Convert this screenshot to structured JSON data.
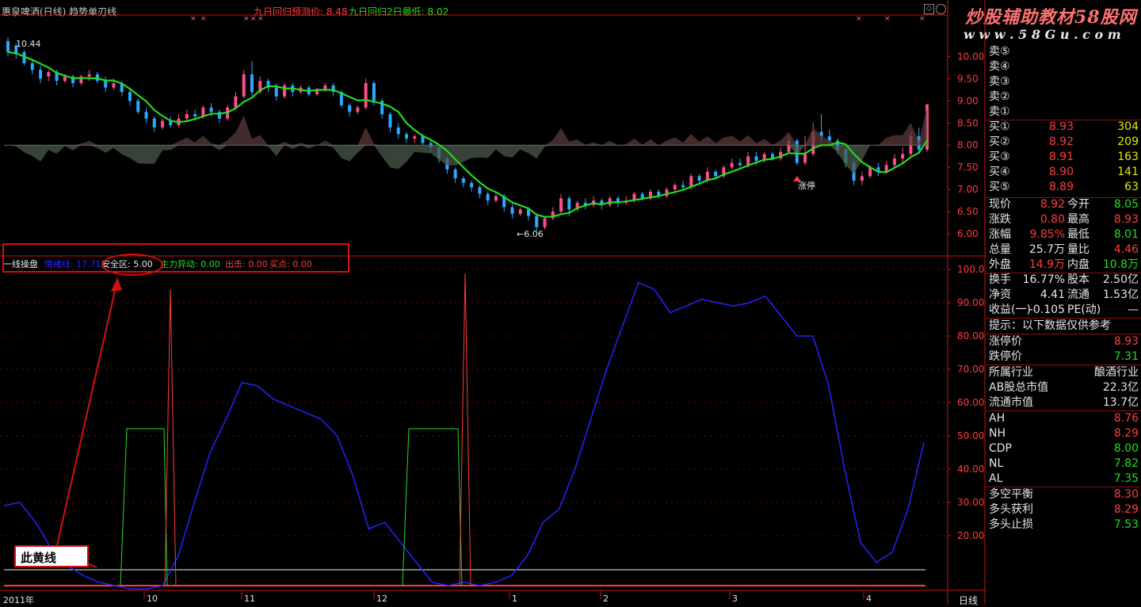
{
  "header": {
    "stock_title": "惠泉啤酒(日线) 趋势单刃线",
    "indicator_1": "九日回归预测价: 8.48",
    "indicator_2": "九日回归2日最低: 8.02",
    "watermark_main": "炒股辅助教材58股网",
    "watermark_url": "w w w . 5 8 G u . c o m"
  },
  "main_chart": {
    "y_ticks": [
      "10.00",
      "9.50",
      "9.00",
      "8.50",
      "8.00",
      "7.50",
      "7.00",
      "6.50",
      "6.00"
    ],
    "high_label": "10.44",
    "low_label": "←6.06",
    "limit_label": "涨停",
    "candles": [
      {
        "o": 10.35,
        "c": 10.1,
        "h": 10.44,
        "l": 10.0
      },
      {
        "o": 10.25,
        "c": 10.05,
        "h": 10.3,
        "l": 9.95
      },
      {
        "o": 10.1,
        "c": 9.85,
        "h": 10.15,
        "l": 9.8
      },
      {
        "o": 9.85,
        "c": 9.7,
        "h": 9.95,
        "l": 9.6
      },
      {
        "o": 9.7,
        "c": 9.5,
        "h": 9.8,
        "l": 9.4
      },
      {
        "o": 9.55,
        "c": 9.65,
        "h": 9.7,
        "l": 9.45
      },
      {
        "o": 9.65,
        "c": 9.45,
        "h": 9.7,
        "l": 9.35
      },
      {
        "o": 9.45,
        "c": 9.55,
        "h": 9.6,
        "l": 9.4
      },
      {
        "o": 9.55,
        "c": 9.4,
        "h": 9.6,
        "l": 9.3
      },
      {
        "o": 9.4,
        "c": 9.55,
        "h": 9.6,
        "l": 9.35
      },
      {
        "o": 9.55,
        "c": 9.6,
        "h": 9.7,
        "l": 9.45
      },
      {
        "o": 9.6,
        "c": 9.45,
        "h": 9.65,
        "l": 9.4
      },
      {
        "o": 9.45,
        "c": 9.3,
        "h": 9.55,
        "l": 9.2
      },
      {
        "o": 9.3,
        "c": 9.4,
        "h": 9.5,
        "l": 9.25
      },
      {
        "o": 9.4,
        "c": 9.2,
        "h": 9.45,
        "l": 9.1
      },
      {
        "o": 9.2,
        "c": 9.0,
        "h": 9.25,
        "l": 8.9
      },
      {
        "o": 9.0,
        "c": 8.75,
        "h": 9.05,
        "l": 8.7
      },
      {
        "o": 8.75,
        "c": 8.6,
        "h": 8.85,
        "l": 8.5
      },
      {
        "o": 8.6,
        "c": 8.4,
        "h": 8.65,
        "l": 8.3
      },
      {
        "o": 8.4,
        "c": 8.55,
        "h": 8.6,
        "l": 8.35
      },
      {
        "o": 8.55,
        "c": 8.45,
        "h": 8.65,
        "l": 8.4
      },
      {
        "o": 8.45,
        "c": 8.6,
        "h": 8.7,
        "l": 8.4
      },
      {
        "o": 8.6,
        "c": 8.7,
        "h": 8.8,
        "l": 8.55
      },
      {
        "o": 8.7,
        "c": 8.65,
        "h": 8.8,
        "l": 8.55
      },
      {
        "o": 8.65,
        "c": 8.85,
        "h": 8.9,
        "l": 8.6
      },
      {
        "o": 8.85,
        "c": 8.75,
        "h": 8.95,
        "l": 8.65
      },
      {
        "o": 8.75,
        "c": 8.6,
        "h": 8.8,
        "l": 8.5
      },
      {
        "o": 8.6,
        "c": 8.85,
        "h": 8.9,
        "l": 8.55
      },
      {
        "o": 8.85,
        "c": 9.1,
        "h": 9.2,
        "l": 8.8
      },
      {
        "o": 9.1,
        "c": 9.6,
        "h": 9.7,
        "l": 9.05
      },
      {
        "o": 9.6,
        "c": 9.2,
        "h": 9.9,
        "l": 9.1
      },
      {
        "o": 9.2,
        "c": 9.45,
        "h": 9.55,
        "l": 9.15
      },
      {
        "o": 9.45,
        "c": 9.3,
        "h": 9.5,
        "l": 9.2
      },
      {
        "o": 9.3,
        "c": 9.1,
        "h": 9.4,
        "l": 9.0
      },
      {
        "o": 9.1,
        "c": 9.35,
        "h": 9.4,
        "l": 9.05
      },
      {
        "o": 9.35,
        "c": 9.2,
        "h": 9.4,
        "l": 9.1
      },
      {
        "o": 9.2,
        "c": 9.3,
        "h": 9.35,
        "l": 9.15
      },
      {
        "o": 9.3,
        "c": 9.15,
        "h": 9.35,
        "l": 9.1
      },
      {
        "o": 9.15,
        "c": 9.25,
        "h": 9.3,
        "l": 9.1
      },
      {
        "o": 9.25,
        "c": 9.35,
        "h": 9.4,
        "l": 9.2
      },
      {
        "o": 9.35,
        "c": 9.2,
        "h": 9.4,
        "l": 9.1
      },
      {
        "o": 9.2,
        "c": 8.9,
        "h": 9.25,
        "l": 8.85
      },
      {
        "o": 8.9,
        "c": 8.75,
        "h": 8.95,
        "l": 8.65
      },
      {
        "o": 8.75,
        "c": 8.85,
        "h": 8.9,
        "l": 8.7
      },
      {
        "o": 8.85,
        "c": 9.4,
        "h": 9.5,
        "l": 8.8
      },
      {
        "o": 9.4,
        "c": 9.0,
        "h": 9.45,
        "l": 8.9
      },
      {
        "o": 9.0,
        "c": 8.7,
        "h": 9.05,
        "l": 8.6
      },
      {
        "o": 8.7,
        "c": 8.4,
        "h": 8.75,
        "l": 8.3
      },
      {
        "o": 8.4,
        "c": 8.25,
        "h": 8.5,
        "l": 8.15
      },
      {
        "o": 8.25,
        "c": 8.15,
        "h": 8.3,
        "l": 8.05
      },
      {
        "o": 8.15,
        "c": 8.2,
        "h": 8.25,
        "l": 8.05
      },
      {
        "o": 8.2,
        "c": 8.05,
        "h": 8.25,
        "l": 8.0
      },
      {
        "o": 8.05,
        "c": 7.95,
        "h": 8.1,
        "l": 7.85
      },
      {
        "o": 7.95,
        "c": 7.7,
        "h": 8.0,
        "l": 7.6
      },
      {
        "o": 7.7,
        "c": 7.45,
        "h": 7.75,
        "l": 7.35
      },
      {
        "o": 7.45,
        "c": 7.25,
        "h": 7.5,
        "l": 7.15
      },
      {
        "o": 7.25,
        "c": 7.15,
        "h": 7.3,
        "l": 7.05
      },
      {
        "o": 7.15,
        "c": 7.05,
        "h": 7.2,
        "l": 6.95
      },
      {
        "o": 7.05,
        "c": 6.9,
        "h": 7.1,
        "l": 6.8
      },
      {
        "o": 6.9,
        "c": 6.75,
        "h": 6.95,
        "l": 6.65
      },
      {
        "o": 6.75,
        "c": 6.85,
        "h": 6.95,
        "l": 6.7
      },
      {
        "o": 6.85,
        "c": 6.6,
        "h": 6.9,
        "l": 6.5
      },
      {
        "o": 6.6,
        "c": 6.45,
        "h": 6.7,
        "l": 6.35
      },
      {
        "o": 6.45,
        "c": 6.55,
        "h": 6.6,
        "l": 6.4
      },
      {
        "o": 6.55,
        "c": 6.4,
        "h": 6.6,
        "l": 6.3
      },
      {
        "o": 6.4,
        "c": 6.15,
        "h": 6.45,
        "l": 6.06
      },
      {
        "o": 6.15,
        "c": 6.35,
        "h": 6.4,
        "l": 6.1
      },
      {
        "o": 6.35,
        "c": 6.5,
        "h": 6.6,
        "l": 6.3
      },
      {
        "o": 6.5,
        "c": 6.8,
        "h": 6.9,
        "l": 6.45
      },
      {
        "o": 6.8,
        "c": 6.55,
        "h": 6.85,
        "l": 6.4
      },
      {
        "o": 6.55,
        "c": 6.7,
        "h": 6.75,
        "l": 6.5
      },
      {
        "o": 6.7,
        "c": 6.65,
        "h": 6.8,
        "l": 6.55
      },
      {
        "o": 6.65,
        "c": 6.75,
        "h": 6.85,
        "l": 6.6
      },
      {
        "o": 6.75,
        "c": 6.65,
        "h": 6.8,
        "l": 6.55
      },
      {
        "o": 6.65,
        "c": 6.8,
        "h": 6.85,
        "l": 6.6
      },
      {
        "o": 6.8,
        "c": 6.7,
        "h": 6.85,
        "l": 6.6
      },
      {
        "o": 6.7,
        "c": 6.75,
        "h": 6.85,
        "l": 6.65
      },
      {
        "o": 6.75,
        "c": 6.9,
        "h": 6.95,
        "l": 6.7
      },
      {
        "o": 6.9,
        "c": 6.8,
        "h": 6.95,
        "l": 6.75
      },
      {
        "o": 6.8,
        "c": 6.95,
        "h": 7.0,
        "l": 6.75
      },
      {
        "o": 6.95,
        "c": 6.85,
        "h": 7.0,
        "l": 6.8
      },
      {
        "o": 6.85,
        "c": 7.0,
        "h": 7.05,
        "l": 6.8
      },
      {
        "o": 7.0,
        "c": 7.1,
        "h": 7.15,
        "l": 6.95
      },
      {
        "o": 7.1,
        "c": 7.05,
        "h": 7.2,
        "l": 7.0
      },
      {
        "o": 7.05,
        "c": 7.3,
        "h": 7.35,
        "l": 7.0
      },
      {
        "o": 7.3,
        "c": 7.2,
        "h": 7.35,
        "l": 7.1
      },
      {
        "o": 7.2,
        "c": 7.4,
        "h": 7.5,
        "l": 7.15
      },
      {
        "o": 7.4,
        "c": 7.3,
        "h": 7.45,
        "l": 7.25
      },
      {
        "o": 7.3,
        "c": 7.5,
        "h": 7.55,
        "l": 7.25
      },
      {
        "o": 7.5,
        "c": 7.6,
        "h": 7.7,
        "l": 7.45
      },
      {
        "o": 7.6,
        "c": 7.55,
        "h": 7.7,
        "l": 7.5
      },
      {
        "o": 7.55,
        "c": 7.75,
        "h": 7.85,
        "l": 7.5
      },
      {
        "o": 7.75,
        "c": 7.65,
        "h": 7.85,
        "l": 7.55
      },
      {
        "o": 7.65,
        "c": 7.8,
        "h": 7.85,
        "l": 7.6
      },
      {
        "o": 7.8,
        "c": 7.7,
        "h": 7.85,
        "l": 7.65
      },
      {
        "o": 7.7,
        "c": 7.85,
        "h": 7.95,
        "l": 7.65
      },
      {
        "o": 7.85,
        "c": 8.1,
        "h": 8.2,
        "l": 7.8
      },
      {
        "o": 8.1,
        "c": 7.6,
        "h": 8.15,
        "l": 7.55
      },
      {
        "o": 7.6,
        "c": 7.8,
        "h": 8.2,
        "l": 7.55
      },
      {
        "o": 7.8,
        "c": 8.3,
        "h": 8.5,
        "l": 7.75
      },
      {
        "o": 8.3,
        "c": 8.2,
        "h": 8.7,
        "l": 8.1
      },
      {
        "o": 8.2,
        "c": 8.1,
        "h": 8.35,
        "l": 8.0
      },
      {
        "o": 8.1,
        "c": 7.9,
        "h": 8.15,
        "l": 7.8
      },
      {
        "o": 7.9,
        "c": 7.6,
        "h": 7.95,
        "l": 7.5
      },
      {
        "o": 7.6,
        "c": 7.2,
        "h": 7.65,
        "l": 7.1
      },
      {
        "o": 7.2,
        "c": 7.3,
        "h": 7.4,
        "l": 7.1
      },
      {
        "o": 7.3,
        "c": 7.5,
        "h": 7.55,
        "l": 7.25
      },
      {
        "o": 7.5,
        "c": 7.4,
        "h": 7.6,
        "l": 7.3
      },
      {
        "o": 7.4,
        "c": 7.55,
        "h": 7.65,
        "l": 7.35
      },
      {
        "o": 7.55,
        "c": 7.7,
        "h": 7.8,
        "l": 7.5
      },
      {
        "o": 7.7,
        "c": 7.8,
        "h": 7.95,
        "l": 7.6
      },
      {
        "o": 7.8,
        "c": 8.2,
        "h": 8.3,
        "l": 7.75
      },
      {
        "o": 8.2,
        "c": 7.9,
        "h": 8.4,
        "l": 7.8
      },
      {
        "o": 7.9,
        "c": 8.92,
        "h": 8.93,
        "l": 7.85
      }
    ]
  },
  "sub_chart": {
    "legend": [
      {
        "text": "一线操盘",
        "color": "#e6e6e6"
      },
      {
        "text": "情绪线: 17.71",
        "color": "#2424ff"
      },
      {
        "text": "安全区: 5.00",
        "color": "#e6e6e6"
      },
      {
        "text": "主力异动: 0.00",
        "color": "#22dd22"
      },
      {
        "text": "出击: 0.00",
        "color": "#ff3c3c"
      },
      {
        "text": "买点: 0.00",
        "color": "#ff3c3c"
      }
    ],
    "y_ticks": [
      "100.0",
      "90.00",
      "80.00",
      "70.00",
      "60.00",
      "50.00",
      "40.00",
      "30.00",
      "20.00"
    ],
    "annotation": "此黄线",
    "mood_line": [
      29,
      30,
      24,
      16,
      11,
      8,
      6,
      5,
      4,
      4,
      5,
      14,
      30,
      45,
      55,
      66,
      65,
      61,
      59,
      57,
      55,
      50,
      38,
      22,
      24,
      18,
      12,
      6,
      5,
      6,
      5,
      6,
      8,
      14,
      24,
      28,
      40,
      55,
      70,
      83,
      96,
      94,
      87,
      89,
      91,
      90,
      89,
      90,
      92,
      86,
      80,
      80,
      65,
      40,
      18,
      12,
      15,
      28,
      48
    ]
  },
  "x_labels": [
    "2011年",
    "10",
    "11",
    "12",
    "1",
    "2",
    "3",
    "4"
  ],
  "period_label": "日线",
  "panel": {
    "sell_rows": [
      {
        "label": "卖⑤",
        "price": "",
        "vol": ""
      },
      {
        "label": "卖④",
        "price": "",
        "vol": ""
      },
      {
        "label": "卖③",
        "price": "",
        "vol": ""
      },
      {
        "label": "卖②",
        "price": "",
        "vol": ""
      },
      {
        "label": "卖①",
        "price": "",
        "vol": ""
      }
    ],
    "buy_rows": [
      {
        "label": "买①",
        "price": "8.93",
        "vol": "304"
      },
      {
        "label": "买②",
        "price": "8.92",
        "vol": "209"
      },
      {
        "label": "买③",
        "price": "8.91",
        "vol": "163"
      },
      {
        "label": "买④",
        "price": "8.90",
        "vol": "141"
      },
      {
        "label": "买⑤",
        "price": "8.89",
        "vol": "63"
      }
    ],
    "quote_rows": [
      {
        "l1": "现价",
        "v1": "8.92",
        "c1": "red",
        "l2": "今开",
        "v2": "8.05",
        "c2": "green"
      },
      {
        "l1": "涨跌",
        "v1": "0.80",
        "c1": "red",
        "l2": "最高",
        "v2": "8.93",
        "c2": "red"
      },
      {
        "l1": "涨幅",
        "v1": "9.85%",
        "c1": "red",
        "l2": "最低",
        "v2": "8.01",
        "c2": "green"
      },
      {
        "l1": "总量",
        "v1": "25.7万",
        "c1": "white",
        "l2": "量比",
        "v2": "4.46",
        "c2": "red"
      },
      {
        "l1": "外盘",
        "v1": "14.9万",
        "c1": "red",
        "l2": "内盘",
        "v2": "10.8万",
        "c2": "green"
      }
    ],
    "fund_rows": [
      {
        "l1": "换手",
        "v1": "16.77%",
        "l2": "股本",
        "v2": "2.50亿"
      },
      {
        "l1": "净资",
        "v1": "4.41",
        "l2": "流通",
        "v2": "1.53亿"
      },
      {
        "l1": "收益(一)",
        "v1": "-0.105",
        "l2": "PE(动)",
        "v2": "—"
      }
    ],
    "hint": "提示：以下数据仅供参考",
    "limit_rows": [
      {
        "label": "涨停价",
        "value": "8.93",
        "color": "red"
      },
      {
        "label": "跌停价",
        "value": "7.31",
        "color": "green"
      }
    ],
    "industry": {
      "label": "所属行业",
      "value": "酿酒行业"
    },
    "cap_rows": [
      {
        "label": "AB股总市值",
        "value": "22.3亿"
      },
      {
        "label": "流通市值",
        "value": "13.7亿"
      }
    ],
    "pivot_rows": [
      {
        "label": "AH",
        "value": "8.76",
        "color": "red"
      },
      {
        "label": "NH",
        "value": "8.29",
        "color": "red"
      },
      {
        "label": "CDP",
        "value": "8.00",
        "color": "green"
      },
      {
        "label": "NL",
        "value": "7.82",
        "color": "green"
      },
      {
        "label": "AL",
        "value": "7.35",
        "color": "green"
      }
    ],
    "balance_rows": [
      {
        "label": "多空平衡",
        "value": "8.30",
        "color": "red"
      },
      {
        "label": "多头获利",
        "value": "8.29",
        "color": "red"
      },
      {
        "label": "多头止损",
        "value": "7.53",
        "color": "green"
      }
    ]
  },
  "colors": {
    "up": "#ff4d88",
    "down": "#2ea8ff",
    "ma": "#22dd22",
    "grid": "#7a0000",
    "axis": "#c81414"
  }
}
